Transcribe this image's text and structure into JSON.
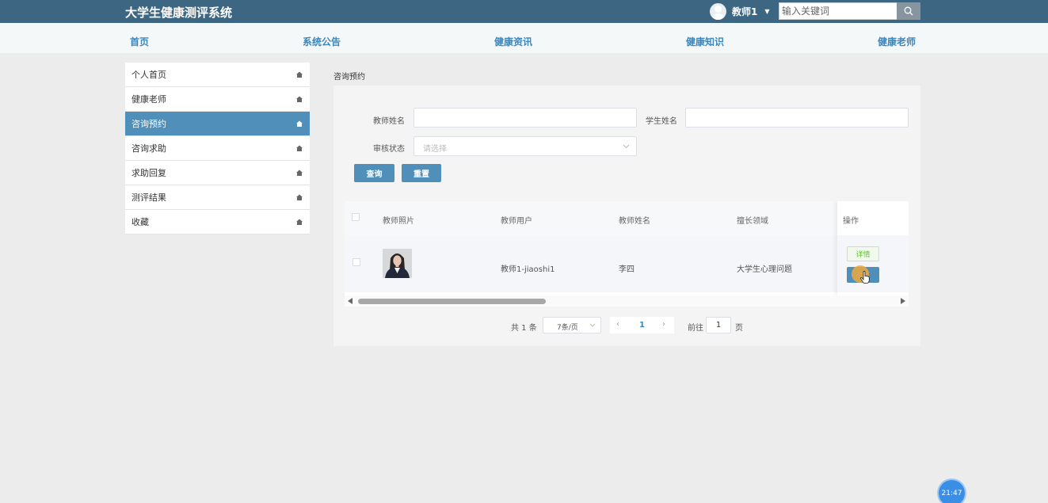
{
  "app": {
    "title": "大学生健康测评系统"
  },
  "header": {
    "username": "教师1",
    "search_placeholder": "输入关键词"
  },
  "nav": {
    "home": "首页",
    "notice": "系统公告",
    "news": "健康资讯",
    "knowledge": "健康知识",
    "teachers": "健康老师"
  },
  "sidebar": {
    "items": [
      {
        "label": "个人首页"
      },
      {
        "label": "健康老师"
      },
      {
        "label": "咨询预约"
      },
      {
        "label": "咨询求助"
      },
      {
        "label": "求助回复"
      },
      {
        "label": "测评结果"
      },
      {
        "label": "收藏"
      }
    ],
    "active_index": 2
  },
  "breadcrumb": "咨询预约",
  "filters": {
    "teacher_name_label": "教师姓名",
    "student_name_label": "学生姓名",
    "status_label": "审核状态",
    "status_placeholder": "请选择",
    "query_button": "查询",
    "reset_button": "重置"
  },
  "table": {
    "columns": [
      "教师照片",
      "教师用户",
      "教师姓名",
      "擅长领域",
      "操作"
    ],
    "rows": [
      {
        "teacher_user": "教师1-jiaoshi1",
        "teacher_name": "李四",
        "specialty": "大学生心理问题",
        "detail_label": "详情"
      }
    ]
  },
  "pagination": {
    "total": "共 1 条",
    "page_size": "7条/页",
    "current_page": "1",
    "goto_label": "前往",
    "goto_value": "1",
    "page_suffix": "页"
  },
  "clock": "21:47",
  "colors": {
    "header_bg": "#3d6682",
    "accent": "#4f8fba",
    "nav_link": "#3b86bd",
    "success": "#67c23a"
  }
}
